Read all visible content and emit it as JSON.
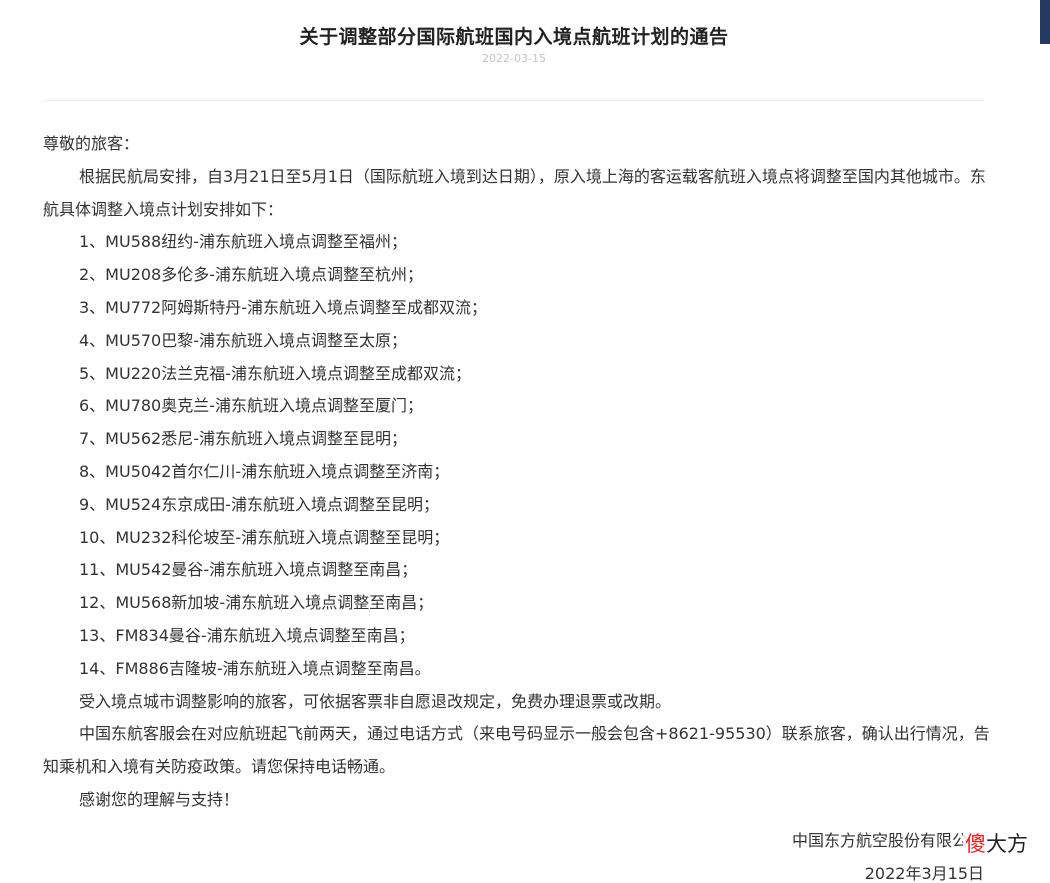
{
  "article": {
    "title": "关于调整部分国际航班国内入境点航班计划的通告",
    "date": "2022-03-15"
  },
  "body": {
    "greeting": "尊敬的旅客：",
    "intro": "根据民航局安排，自3月21日至5月1日（国际航班入境到达日期），原入境上海的客运载客航班入境点将调整至国内其他城市。东航具体调整入境点计划安排如下：",
    "items": [
      "1、MU588纽约-浦东航班入境点调整至福州；",
      "2、MU208多伦多-浦东航班入境点调整至杭州；",
      "3、MU772阿姆斯特丹-浦东航班入境点调整至成都双流；",
      "4、MU570巴黎-浦东航班入境点调整至太原；",
      "5、MU220法兰克福-浦东航班入境点调整至成都双流；",
      "6、MU780奥克兰-浦东航班入境点调整至厦门；",
      "7、MU562悉尼-浦东航班入境点调整至昆明；",
      "8、MU5042首尔仁川-浦东航班入境点调整至济南；",
      "9、MU524东京成田-浦东航班入境点调整至昆明；",
      "10、MU232科伦坡至-浦东航班入境点调整至昆明；",
      "11、MU542曼谷-浦东航班入境点调整至南昌；",
      "12、MU568新加坡-浦东航班入境点调整至南昌；",
      "13、FM834曼谷-浦东航班入境点调整至南昌；",
      "14、FM886吉隆坡-浦东航班入境点调整至南昌。"
    ],
    "refund_note": "受入境点城市调整影响的旅客，可依据客票非自愿退改规定，免费办理退票或改期。",
    "contact_note": "中国东航客服会在对应航班起飞前两天，通过电话方式（来电号码显示一般会包含+8621-95530）联系旅客，确认出行情况，告知乘机和入境有关防疫政策。请您保持电话畅通。",
    "thanks": "感谢您的理解与支持！"
  },
  "signature": {
    "company": "中国东方航空股份有限公司",
    "date": "2022年3月15日"
  },
  "watermark": {
    "char1": "傻",
    "rest": "大方"
  },
  "colors": {
    "accent_bar": "#243a5e",
    "date_text": "#c4c4c4",
    "watermark_accent": "#e02424"
  }
}
